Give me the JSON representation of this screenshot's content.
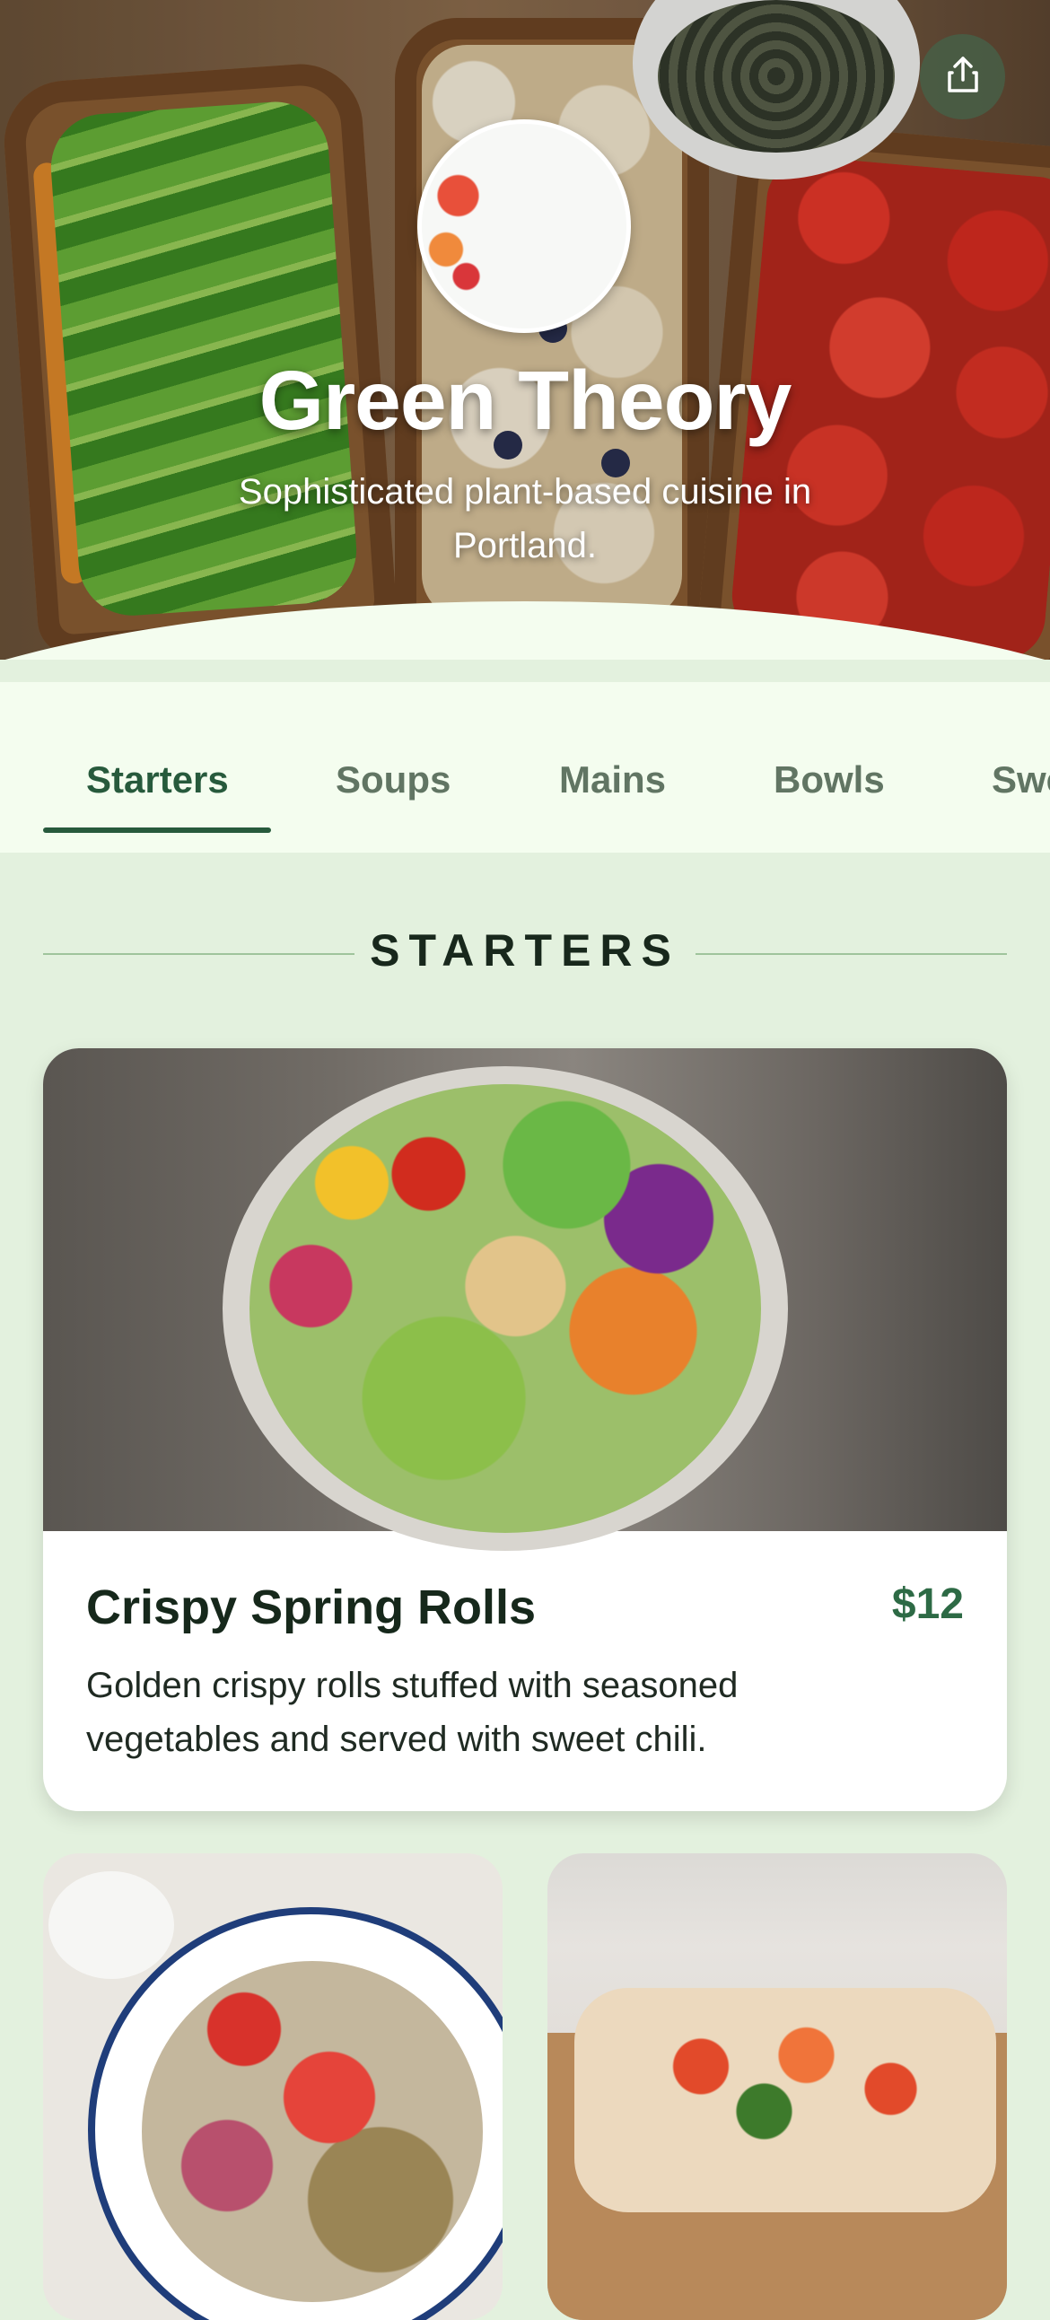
{
  "hero": {
    "title": "Green Theory",
    "subtitle": "Sophisticated plant-based cuisine in Portland.",
    "share_icon": "share-icon"
  },
  "tabs": [
    {
      "label": "Starters",
      "active": true
    },
    {
      "label": "Soups",
      "active": false
    },
    {
      "label": "Mains",
      "active": false
    },
    {
      "label": "Bowls",
      "active": false
    },
    {
      "label": "Sweets",
      "active": false
    }
  ],
  "section": {
    "title": "STARTERS"
  },
  "featured_item": {
    "name": "Crispy Spring Rolls",
    "price": "$12",
    "description": "Golden crispy rolls stuffed with seasoned vegetables and served with sweet chili."
  },
  "colors": {
    "accent": "#275a3c",
    "background": "#e3f1de",
    "tab_bar": "#f4fdef"
  }
}
